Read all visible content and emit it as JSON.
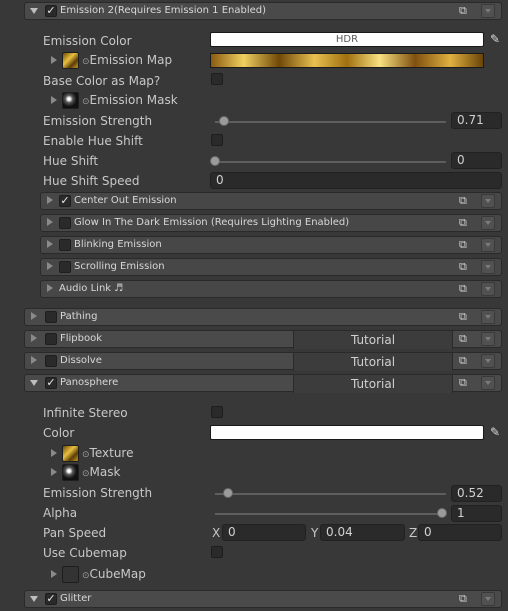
{
  "emission2": {
    "title": "Emission 2(Requires Emission 1 Enabled)",
    "color_label": "Emission Color",
    "color_value_text": "HDR",
    "map_label": "Emission Map",
    "base_color_label": "Base Color as Map?",
    "mask_label": "Emission Mask",
    "strength_label": "Emission Strength",
    "strength_value": "0.71",
    "hue_shift_enable_label": "Enable Hue Shift",
    "hue_shift_label": "Hue Shift",
    "hue_shift_value": "0",
    "hue_shift_speed_label": "Hue Shift Speed",
    "hue_shift_speed_value": "0",
    "subsections": [
      {
        "label": "Center Out Emission",
        "checked": true
      },
      {
        "label": "Glow In The Dark Emission (Requires Lighting Enabled)",
        "checked": false
      },
      {
        "label": "Blinking Emission",
        "checked": false
      },
      {
        "label": "Scrolling Emission",
        "checked": false
      },
      {
        "label": "Audio Link ♬",
        "checked": null
      }
    ]
  },
  "sections": {
    "pathing": "Pathing",
    "flipbook": "Flipbook",
    "dissolve": "Dissolve",
    "panosphere": "Panosphere",
    "glitter": "Glitter",
    "tutorial_label": "Tutorial"
  },
  "panosphere": {
    "infinite_stereo_label": "Infinite Stereo",
    "color_label": "Color",
    "texture_label": "Texture",
    "mask_label": "Mask",
    "strength_label": "Emission Strength",
    "strength_value": "0.52",
    "alpha_label": "Alpha",
    "alpha_value": "1",
    "pan_speed_label": "Pan Speed",
    "pan_x_label": "X",
    "pan_x_value": "0",
    "pan_y_label": "Y",
    "pan_y_value": "0.04",
    "pan_z_label": "Z",
    "pan_z_value": "0",
    "use_cubemap_label": "Use Cubemap",
    "cubemap_label": "CubeMap"
  },
  "colors": {
    "background": "#383838",
    "header": "#4a4a4a",
    "field": "#2a2a2a"
  }
}
